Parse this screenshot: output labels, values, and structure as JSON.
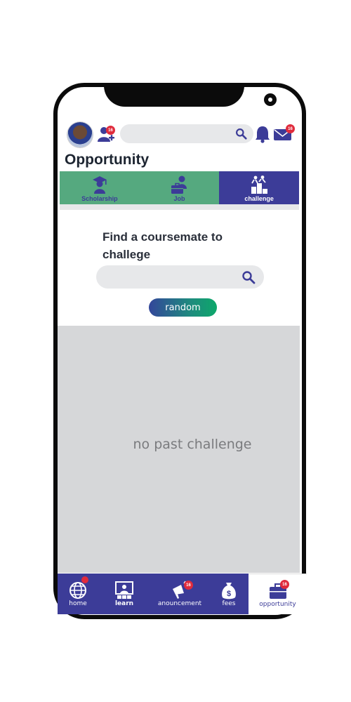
{
  "header": {
    "search_placeholder": "",
    "add_friend_badge": "16",
    "mail_badge": "16"
  },
  "page": {
    "title": "Opportunity"
  },
  "tabs": [
    {
      "label": "Scholarship",
      "icon": "graduate-icon",
      "active": false
    },
    {
      "label": "Job",
      "icon": "briefcase-person-icon",
      "active": false
    },
    {
      "label": "challenge",
      "icon": "challenge-icon",
      "active": true
    }
  ],
  "challenge": {
    "find_title": "Find a coursemate to challege",
    "search_placeholder": "",
    "random_label": "random",
    "empty_text": "no past challenge"
  },
  "bottom_nav": [
    {
      "label": "home",
      "icon": "globe-icon",
      "badge": ""
    },
    {
      "label": "learn",
      "icon": "classroom-icon",
      "badge": ""
    },
    {
      "label": "anouncement",
      "icon": "megaphone-icon",
      "badge": "16"
    },
    {
      "label": "fees",
      "icon": "money-bag-icon",
      "badge": ""
    },
    {
      "label": "opportunity",
      "icon": "briefcase-icon",
      "badge": "16"
    }
  ],
  "colors": {
    "primary": "#3c3c98",
    "tab_green": "#55a97f",
    "badge_red": "#e02b3c",
    "panel_gray": "#d6d7d9"
  }
}
